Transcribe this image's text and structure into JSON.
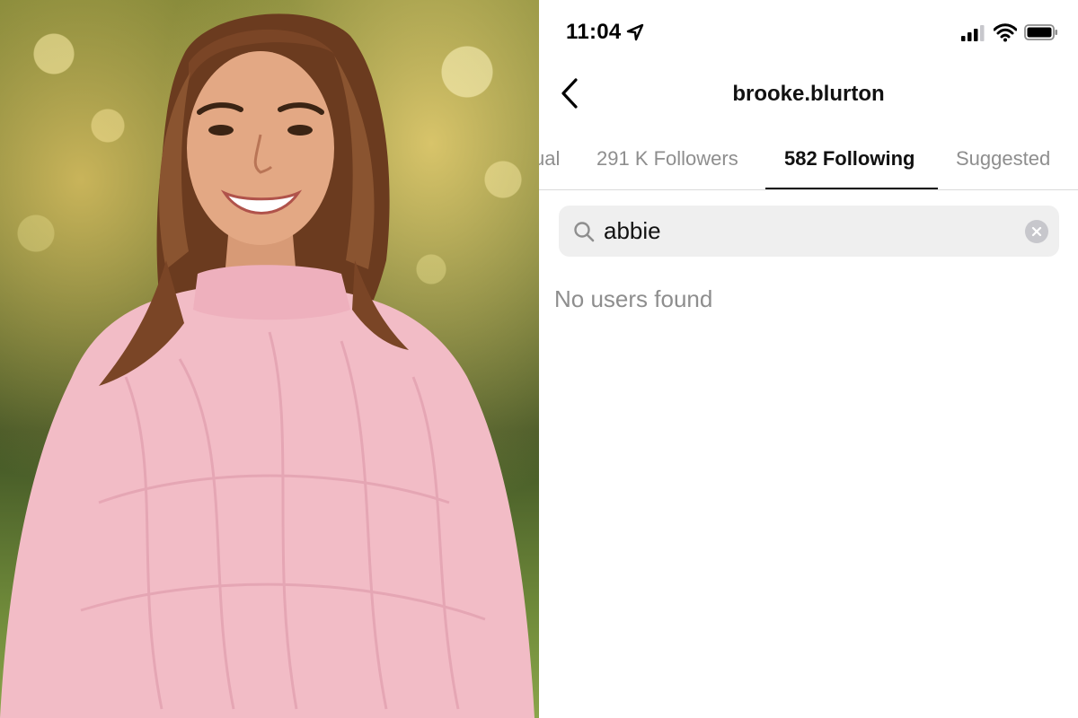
{
  "photo": {
    "subject": "woman-in-pink-knit-sweater"
  },
  "status_bar": {
    "time": "11:04",
    "icons": [
      "location-arrow-icon",
      "cellular-signal-icon",
      "wifi-icon",
      "battery-icon"
    ]
  },
  "nav": {
    "title": "brooke.blurton",
    "back_icon": "chevron-left-icon"
  },
  "tabs": [
    {
      "label": "ual",
      "active": false
    },
    {
      "label": "291 K Followers",
      "active": false
    },
    {
      "label": "582 Following",
      "active": true
    },
    {
      "label": "Suggested",
      "active": false
    }
  ],
  "search": {
    "value": "abbie",
    "icon": "search-icon",
    "clear_icon": "clear-icon"
  },
  "results": {
    "empty_message": "No users found"
  },
  "colors": {
    "sweater": "#f2bcc6",
    "tab_active": "#111111",
    "tab_inactive": "#8e8e8e",
    "search_bg": "#efefef"
  }
}
